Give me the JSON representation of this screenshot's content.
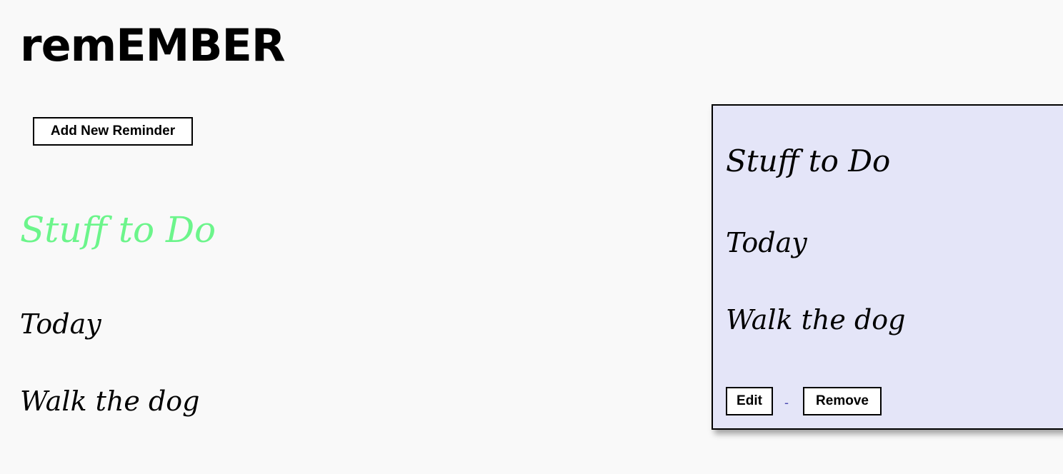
{
  "app": {
    "title": "remEMBER"
  },
  "toolbar": {
    "add_label": "Add New Reminder"
  },
  "list": {
    "title": "Stuff to Do",
    "date": "Today",
    "task": "Walk the dog",
    "title_color": "#6cf58b"
  },
  "detail": {
    "title": "Stuff to Do",
    "date": "Today",
    "task": "Walk the dog",
    "edit_label": "Edit",
    "separator": "-",
    "remove_label": "Remove",
    "background_color": "#e4e5f8"
  }
}
